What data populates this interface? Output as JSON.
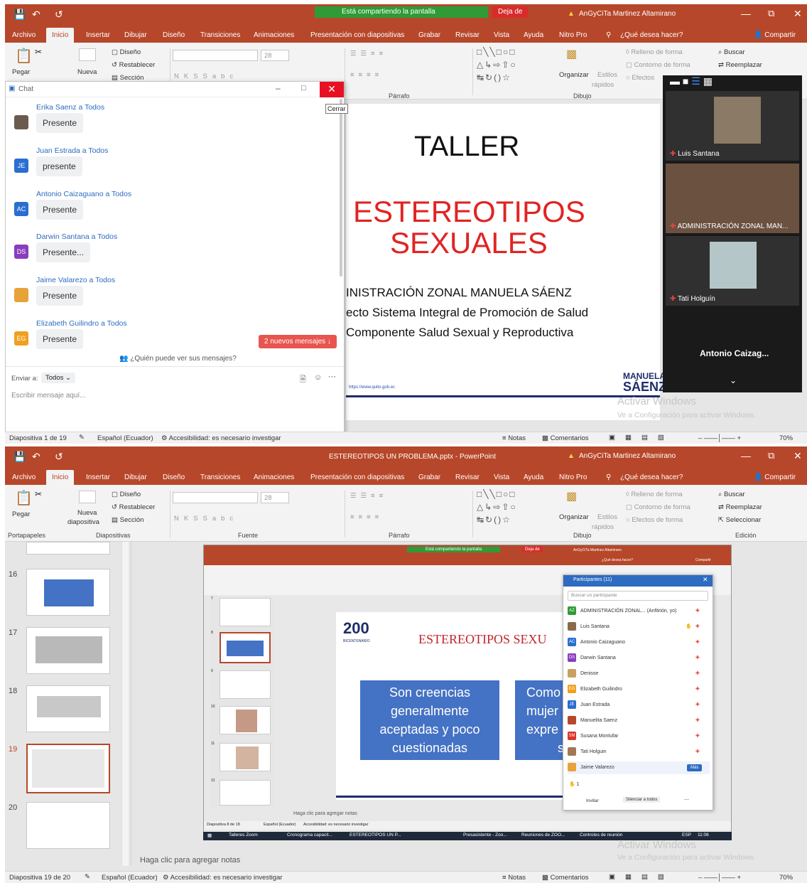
{
  "shot1": {
    "share_banner": "Está compartiendo la pantalla",
    "stop_share": "Deja de",
    "user": "AnGyCiTa Martinez Altamirano",
    "tabs": [
      "Archivo",
      "Inicio",
      "Insertar",
      "Dibujar",
      "Diseño",
      "Transiciones",
      "Animaciones",
      "Presentación con diapositivas",
      "Grabar",
      "Revisar",
      "Vista",
      "Ayuda",
      "Nitro Pro"
    ],
    "tell_me": "¿Qué desea hacer?",
    "share": "Compartir",
    "ribbon": {
      "paste": "Pegar",
      "new_slide": "Nueva",
      "design": "Diseño",
      "reset": "Restablecer",
      "section": "Sección",
      "font_size": "28",
      "arrange": "Organizar",
      "styles": "Estilos",
      "quick": "rápidos",
      "fill": "Relleno de forma",
      "outline": "Contorno de forma",
      "effects": "Efectos",
      "find": "Buscar",
      "replace": "Reemplazar",
      "group_paragraph": "Párrafo",
      "group_draw": "Dibujo"
    },
    "chat": {
      "title": "Chat",
      "close_tooltip": "Cerrar",
      "messages": [
        {
          "sender": "Erika Saenz a Todos",
          "text": "Presente",
          "initials": "",
          "color": "#6b5a4e"
        },
        {
          "sender": "Juan Estrada a Todos",
          "text": "presente",
          "initials": "JE",
          "color": "#2a6ed1"
        },
        {
          "sender": "Antonio Caizaguano a Todos",
          "text": "Presente",
          "initials": "AC",
          "color": "#2a6ed1"
        },
        {
          "sender": "Darwin Santana a Todos",
          "text": "Presente...",
          "initials": "DS",
          "color": "#8a3dbd"
        },
        {
          "sender": "Jaime Valarezo a Todos",
          "text": "Presente",
          "initials": "",
          "color": "#e8a23a"
        },
        {
          "sender": "Elizabeth Guilindro a Todos",
          "text": "Presente",
          "initials": "EG",
          "color": "#f0a020"
        }
      ],
      "new_messages": "2 nuevos mensajes",
      "who_can_see": "¿Quién puede ver sus mensajes?",
      "send_to": "Enviar a:",
      "send_to_value": "Todos",
      "placeholder": "Escribir mensaje aquí..."
    },
    "slide": {
      "title": "TALLER",
      "subtitle_1": "ESTEREOTIPOS",
      "subtitle_2": "SEXUALES",
      "line1": "INISTRACIÓN ZONAL MANUELA SÁENZ",
      "line2": "ecto Sistema Integral de Promoción de Salud",
      "line3": "Componente Salud Sexual y Reproductiva",
      "url": "https://www.quito.gob.ec",
      "logo_1": "MANUELA",
      "logo_2": "SÁENZ"
    },
    "videos": [
      {
        "name": "Luis Santana"
      },
      {
        "name": "ADMINISTRACIÓN ZONAL MAN..."
      },
      {
        "name": "Tati Holguín"
      },
      {
        "name": "Antonio Caizag..."
      }
    ],
    "watermark_1": "Activar Windows",
    "watermark_2": "Ve a Configuración para activar Windows.",
    "status": {
      "slide": "Diapositiva 1 de 19",
      "lang": "Español (Ecuador)",
      "access": "Accesibilidad: es necesario investigar",
      "notes": "Notas",
      "comments": "Comentarios",
      "zoom": "70%"
    }
  },
  "shot2": {
    "title": "ESTEREOTIPOS UN PROBLEMA.pptx - PowerPoint",
    "user": "AnGyCiTa Martinez Altamirano",
    "tabs": [
      "Archivo",
      "Inicio",
      "Insertar",
      "Dibujar",
      "Diseño",
      "Transiciones",
      "Animaciones",
      "Presentación con diapositivas",
      "Grabar",
      "Revisar",
      "Vista",
      "Ayuda",
      "Nitro Pro"
    ],
    "tell_me": "¿Qué desea hacer?",
    "share": "Compartir",
    "ribbon": {
      "paste": "Pegar",
      "new_slide": "Nueva",
      "new_slide_2": "diapositiva",
      "design": "Diseño",
      "reset": "Restablecer",
      "section": "Sección",
      "font_size": "28",
      "arrange": "Organizar",
      "styles": "Estilos",
      "quick": "rápidos",
      "fill": "Relleno de forma",
      "outline": "Contorno de forma",
      "effects": "Efectos de forma",
      "find": "Buscar",
      "replace": "Reemplazar",
      "select": "Seleccionar",
      "group_clipboard": "Portapapeles",
      "group_slides": "Diapositivas",
      "group_font": "Fuente",
      "group_paragraph": "Párrafo",
      "group_draw": "Dibujo",
      "group_edit": "Edición"
    },
    "thumbs": [
      "16",
      "17",
      "18",
      "19",
      "20"
    ],
    "inner": {
      "share_banner": "Está compartiendo la pantalla",
      "stop": "Deja de",
      "user": "AnGyCiTa Martinez Altamirano",
      "tell_me": "¿Qué desea hacer?",
      "share": "Compartir",
      "thumbs": [
        "7",
        "8",
        "9",
        "10",
        "11",
        "12"
      ],
      "slide_title": "ESTEREOTIPOS SEXU",
      "logo_text": "BICENTENARIO",
      "box1": "Son creencias generalmente aceptadas y poco cuestionadas",
      "box2_1": "Como",
      "box2_2": "mujer",
      "box2_3": "expre",
      "box2_4": "se",
      "notes": "Haga clic para agregar notas",
      "status": "Diapositiva 8 de 18",
      "status_lang": "Español (Ecuador)",
      "status_access": "Accesibilidad: es necesario investigar",
      "taskbar": [
        "Talleres Zoom",
        "Cronograma capacit...",
        "ESTEREOTIPOS UN P...",
        "Presasistente - Zoo...",
        "Reuniones de ZOO...",
        "Controles de reunión"
      ],
      "time": "11:06",
      "tb_lang": "ESP"
    },
    "participants": {
      "title": "Participantes (11)",
      "search": "Buscar un participante",
      "rows": [
        {
          "name": "ADMINISTRACIÓN ZONAL... (Anfitrión, yo)",
          "initials": "AZ",
          "color": "#2e9b36"
        },
        {
          "name": "Luis Santana",
          "initials": "",
          "color": "#8a6a4a"
        },
        {
          "name": "Antonio Caizaguano",
          "initials": "AC",
          "color": "#2a6ed1"
        },
        {
          "name": "Darwin Santana",
          "initials": "DS",
          "color": "#8a3dbd"
        },
        {
          "name": "Denisse",
          "initials": "",
          "color": "#c8a060"
        },
        {
          "name": "Elizabeth Guilindro",
          "initials": "EG",
          "color": "#f0a020"
        },
        {
          "name": "Juan Estrada",
          "initials": "JE",
          "color": "#2a6ed1"
        },
        {
          "name": "Manuelita Saenz",
          "initials": "",
          "color": "#b7472a"
        },
        {
          "name": "Susana Montufar",
          "initials": "SM",
          "color": "#d9352c"
        },
        {
          "name": "Tati Holguin",
          "initials": "",
          "color": "#a07858"
        },
        {
          "name": "Jaime Valarezo",
          "initials": "",
          "color": "#e8a23a"
        }
      ],
      "more": "Más",
      "invite": "Invitar",
      "mute": "Silenciar a todos",
      "hand_count": "1"
    },
    "notes": "Haga clic para agregar notas",
    "watermark_1": "Activar Windows",
    "watermark_2": "Ve a Configuración para activar Windows.",
    "status": {
      "slide": "Diapositiva 19 de 20",
      "lang": "Español (Ecuador)",
      "access": "Accesibilidad: es necesario investigar",
      "notes": "Notas",
      "comments": "Comentarios",
      "zoom": "70%"
    }
  }
}
